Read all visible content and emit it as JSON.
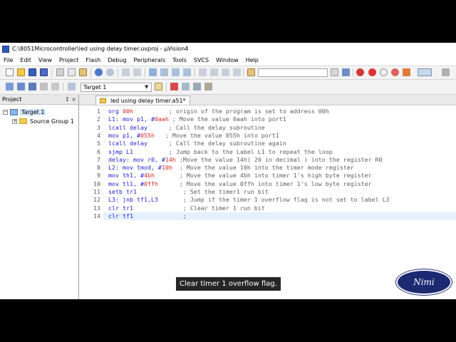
{
  "window": {
    "title": "C:\\8051Microcontroller\\led using delay timer.uvproj - µVision4"
  },
  "menubar": {
    "items": [
      "File",
      "Edit",
      "View",
      "Project",
      "Flash",
      "Debug",
      "Peripherals",
      "Tools",
      "SVCS",
      "Window",
      "Help"
    ]
  },
  "toolbar2": {
    "target_select": "Target 1"
  },
  "project_panel": {
    "title": "Project",
    "header_icons": "↕ ×",
    "tree": {
      "target": "Target 1",
      "group": "Source Group 1"
    }
  },
  "editor": {
    "tab_label": "led using delay timer.a51*",
    "lines": [
      {
        "n": "1",
        "segs": [
          [
            "kw",
            "org "
          ],
          [
            "num",
            "00h"
          ],
          [
            "cmt",
            "          ; origin of the program is set to address 00h"
          ]
        ]
      },
      {
        "n": "2",
        "segs": [
          [
            "kw",
            "L1: mov p1, #"
          ],
          [
            "num",
            "0aah"
          ],
          [
            "cmt",
            " ; Move the value 0aah into port1"
          ]
        ]
      },
      {
        "n": "3",
        "segs": [
          [
            "kw",
            "lcall delay"
          ],
          [
            "cmt",
            "      ; Call the delay subroutine"
          ]
        ]
      },
      {
        "n": "4",
        "segs": [
          [
            "kw",
            "mov p1, #"
          ],
          [
            "num",
            "055h"
          ],
          [
            "cmt",
            "   ; Move the value 055h into port1"
          ]
        ]
      },
      {
        "n": "5",
        "segs": [
          [
            "kw",
            "lcall delay"
          ],
          [
            "cmt",
            "      ; Call the delay subroutine again"
          ]
        ]
      },
      {
        "n": "6",
        "segs": [
          [
            "kw",
            "sjmp L1"
          ],
          [
            "cmt",
            "          ; Jump back to the Label L1 to repeat the loop"
          ]
        ]
      },
      {
        "n": "7",
        "segs": [
          [
            "kw",
            "delay: mov r0, #"
          ],
          [
            "num",
            "14h"
          ],
          [
            "cmt",
            " ;Move the value 14h( 20 in decimal ) into the register R0"
          ]
        ]
      },
      {
        "n": "8",
        "segs": [
          [
            "kw",
            "L2: mov tmod, #"
          ],
          [
            "num",
            "10h"
          ],
          [
            "cmt",
            "  ; Move the value 10h into the timer mode register"
          ]
        ]
      },
      {
        "n": "9",
        "segs": [
          [
            "kw",
            "mov th1, #"
          ],
          [
            "num",
            "4bh"
          ],
          [
            "cmt",
            "       ; Move the value 4bh into timer 1's high byte register"
          ]
        ]
      },
      {
        "n": "10",
        "segs": [
          [
            "kw",
            "mov tl1, #"
          ],
          [
            "num",
            "0ffh"
          ],
          [
            "cmt",
            "      ; Move the value 0ffh into timer 1's low byte register"
          ]
        ]
      },
      {
        "n": "11",
        "segs": [
          [
            "kw",
            "setb tr1"
          ],
          [
            "cmt",
            "             ; Set the timer1 run bit"
          ]
        ]
      },
      {
        "n": "12",
        "segs": [
          [
            "kw",
            "L3: jnb tf1,L3"
          ],
          [
            "cmt",
            "       ; Jump if the timer 1 overflow flag is not set to label L3"
          ]
        ]
      },
      {
        "n": "13",
        "segs": [
          [
            "kw",
            "clr tr1"
          ],
          [
            "cmt",
            "              ; Clear timer 1 run bit"
          ]
        ]
      },
      {
        "n": "14",
        "segs": [
          [
            "kw",
            "clr tf1"
          ],
          [
            "cmt",
            "              ;"
          ]
        ]
      }
    ]
  },
  "overlay": {
    "subtitle": "Clear timer 1 overflow flag.",
    "logo_text": "Nimi"
  },
  "colors": {
    "keyword": "#1f1fd2",
    "number": "#d22a2a",
    "comment": "#5f5f5f",
    "current_line": "#e5f0ff",
    "logo_bg": "#1c2a72"
  }
}
